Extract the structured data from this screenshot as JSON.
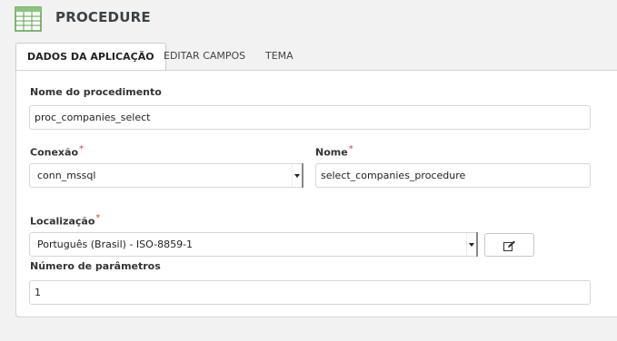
{
  "header": {
    "title": "PROCEDURE",
    "icon": "table-grid-icon"
  },
  "tabs": [
    {
      "label": "DADOS DA APLICAÇÃO",
      "active": true
    },
    {
      "label": "EDITAR CAMPOS",
      "active": false
    },
    {
      "label": "TEMA",
      "active": false
    }
  ],
  "form": {
    "procedure_name": {
      "label": "Nome do procedimento",
      "value": "proc_companies_select"
    },
    "connection": {
      "label": "Conexão",
      "required_mark": "*",
      "value": "conn_mssql"
    },
    "name": {
      "label": "Nome",
      "required_mark": "*",
      "value": "select_companies_procedure"
    },
    "locale": {
      "label": "Localização",
      "required_mark": "*",
      "value": "Português (Brasil) - ISO-8859-1",
      "edit_icon": "edit-icon"
    },
    "param_count": {
      "label": "Número de parâmetros",
      "value": "1"
    }
  },
  "colors": {
    "required": "#e03b3b",
    "icon_green": "#5aa04a",
    "background": "#f2f2f2"
  }
}
